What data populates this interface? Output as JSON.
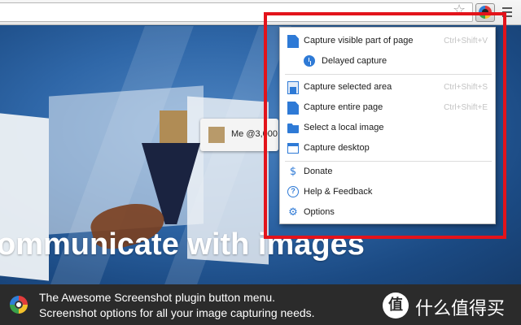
{
  "browser": {
    "star_glyph": "☆",
    "extension_icon": "awesome-screenshot-icon",
    "menu_icon": "hamburger-icon"
  },
  "page": {
    "card_text": "Me @3,000",
    "headline": "ommunicate with images"
  },
  "menu": {
    "items": [
      {
        "label": "Capture visible part of page",
        "shortcut": "Ctrl+Shift+V",
        "icon": "page-icon"
      },
      {
        "label": "Delayed capture",
        "shortcut": "",
        "icon": "clock-icon"
      },
      {
        "label": "Capture selected area",
        "shortcut": "Ctrl+Shift+S",
        "icon": "selection-icon"
      },
      {
        "label": "Capture entire page",
        "shortcut": "Ctrl+Shift+E",
        "icon": "page-icon"
      },
      {
        "label": "Select a local image",
        "shortcut": "",
        "icon": "folder-icon"
      },
      {
        "label": "Capture desktop",
        "shortcut": "",
        "icon": "desktop-icon"
      },
      {
        "label": "Donate",
        "shortcut": "",
        "icon": "heart-dollar-icon",
        "glyph": "$"
      },
      {
        "label": "Help & Feedback",
        "shortcut": "",
        "icon": "help-icon",
        "glyph": "?"
      },
      {
        "label": "Options",
        "shortcut": "",
        "icon": "gear-icon",
        "glyph": "⚙"
      }
    ]
  },
  "caption": {
    "line1": "The Awesome Screenshot plugin button menu.",
    "line2": "Screenshot options for all your image capturing needs."
  },
  "watermark": {
    "badge": "值",
    "text": "什么值得买"
  },
  "colors": {
    "accent": "#2e7ad6",
    "highlight": "#e3131b",
    "caption_bg": "#2b2b2b"
  }
}
